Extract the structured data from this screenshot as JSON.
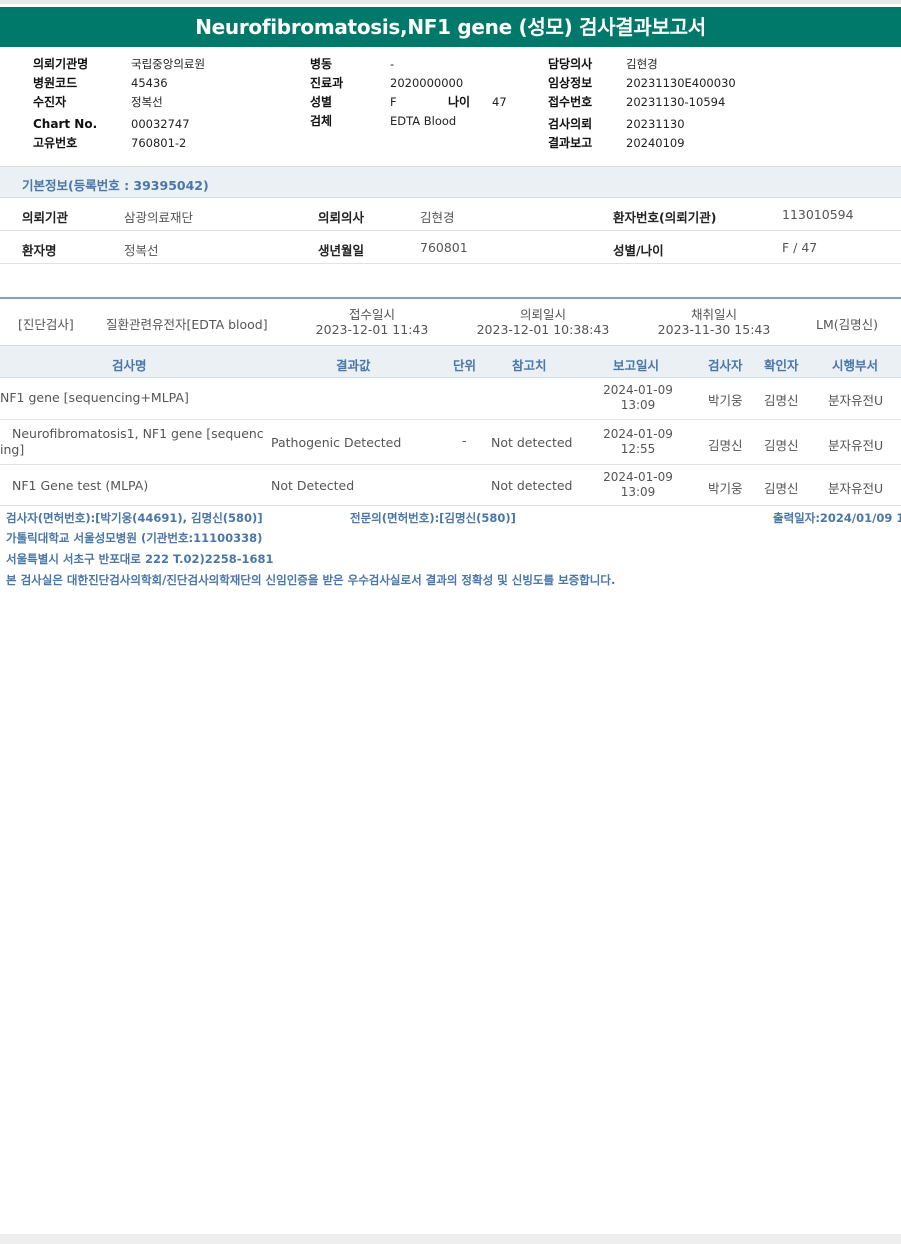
{
  "report": {
    "title": "Neurofibromatosis,NF1 gene (성모) 검사결과보고서"
  },
  "header": {
    "col1": [
      {
        "label": "의뢰기관명",
        "value": "국립중앙의료원"
      },
      {
        "label": "병원코드",
        "value": "45436"
      },
      {
        "label": "수진자",
        "value": "정복선"
      },
      {
        "label": "Chart No.",
        "value": "00032747"
      },
      {
        "label": "고유번호",
        "value": "760801-2"
      }
    ],
    "col2": [
      {
        "label": "병동",
        "value": "-"
      },
      {
        "label": "진료과",
        "value": "2020000000"
      },
      {
        "label": "성별",
        "value": "F",
        "extra_label": "나이",
        "extra_value": "47"
      },
      {
        "label": "검체",
        "value": "EDTA Blood"
      }
    ],
    "col3": [
      {
        "label": "담당의사",
        "value": "김현경"
      },
      {
        "label": "임상정보",
        "value": "20231130E400030"
      },
      {
        "label": "접수번호",
        "value": "20231130-10594"
      },
      {
        "label": "검사의뢰",
        "value": "20231130"
      },
      {
        "label": "결과보고",
        "value": "20240109"
      }
    ]
  },
  "basic_info": {
    "section_title": "기본정보(등록번호 : 39395042)",
    "rows": [
      [
        {
          "label": "의뢰기관",
          "value": "삼광의료재단"
        },
        {
          "label": "의뢰의사",
          "value": "김현경"
        },
        {
          "label": "환자번호(의뢰기관)",
          "value": "113010594"
        }
      ],
      [
        {
          "label": "환자명",
          "value": "정복선"
        },
        {
          "label": "생년월일",
          "value": "760801"
        },
        {
          "label": "성별/나이",
          "value": "F / 47"
        }
      ]
    ]
  },
  "order": {
    "category": "[진단검사]",
    "name": "질환관련유전자[EDTA blood]",
    "received_label": "접수일시",
    "received": "2023-12-01 11:43",
    "requested_label": "의뢰일시",
    "requested": "2023-12-01 10:38:43",
    "collected_label": "채취일시",
    "collected": "2023-11-30 15:43",
    "lab": "LM(김명신)"
  },
  "results_table": {
    "headers": [
      "검사명",
      "결과값",
      "단위",
      "참고치",
      "보고일시",
      "검사자",
      "확인자",
      "시행부서"
    ],
    "rows": [
      {
        "test": "NF1 gene [sequencing+MLPA]",
        "test2": "",
        "result": "",
        "unit": "",
        "reference": "",
        "date": "2024-01-09",
        "time": "13:09",
        "tester": "박기웅",
        "confirmer": "김명신",
        "dept": "분자유전U"
      },
      {
        "test": "Neurofibromatosis1, NF1 gene [sequenc",
        "test2": "ing]",
        "result": "Pathogenic Detected",
        "unit": "-",
        "reference": "Not detected",
        "date": "2024-01-09",
        "time": "12:55",
        "tester": "김명신",
        "confirmer": "김명신",
        "dept": "분자유전U"
      },
      {
        "test": "NF1 Gene test (MLPA)",
        "test2": "",
        "result": "Not Detected",
        "unit": "",
        "reference": "Not detected",
        "date": "2024-01-09",
        "time": "13:09",
        "tester": "박기웅",
        "confirmer": "김명신",
        "dept": "분자유전U"
      }
    ]
  },
  "footer": {
    "testers": "검사자(면허번호):[박기웅(44691), 김명신(580)]",
    "specialist": "전문의(면허번호):[김명신(580)]",
    "print_date": "출력일자:2024/01/09 1",
    "institution": "가톨릭대학교 서울성모병원 (기관번호:11100338)",
    "address": "서울특별시 서초구 반포대로 222 T.02)2258-1681",
    "certification": "본 검사실은 대한진단검사의학회/진단검사의학재단의 신임인증을 받은 우수검사실로서 결과의 정확성 및 신빙도를 보증합니다."
  }
}
